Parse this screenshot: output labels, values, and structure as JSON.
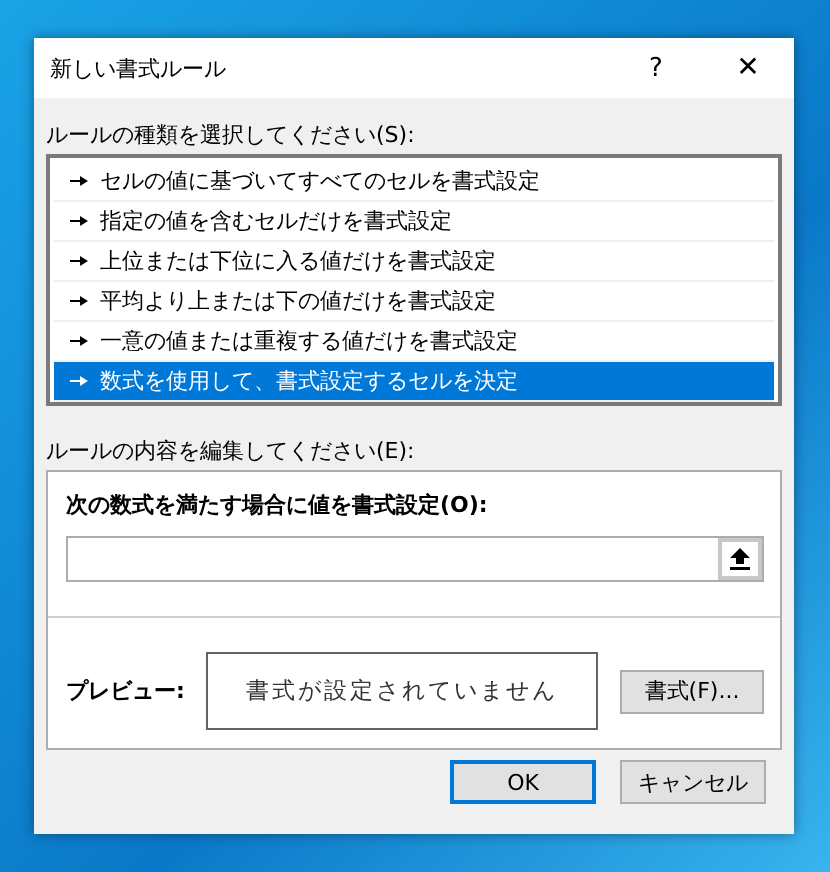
{
  "window": {
    "title": "新しい書式ルール",
    "help": "?",
    "close": "✕"
  },
  "rule_type": {
    "label": "ルールの種類を選択してください(S):",
    "items": [
      {
        "label": "セルの値に基づいてすべてのセルを書式設定",
        "selected": false
      },
      {
        "label": "指定の値を含むセルだけを書式設定",
        "selected": false
      },
      {
        "label": "上位または下位に入る値だけを書式設定",
        "selected": false
      },
      {
        "label": "平均より上または下の値だけを書式設定",
        "selected": false
      },
      {
        "label": "一意の値または重複する値だけを書式設定",
        "selected": false
      },
      {
        "label": "数式を使用して、書式設定するセルを決定",
        "selected": true
      }
    ]
  },
  "rule_edit": {
    "label": "ルールの内容を編集してください(E):",
    "formula_label": "次の数式を満たす場合に値を書式設定(O):",
    "preview_label": "プレビュー:",
    "preview_text": "書式が設定されていません",
    "format_button": "書式(F)..."
  },
  "buttons": {
    "ok": "OK",
    "cancel": "キャンセル"
  }
}
